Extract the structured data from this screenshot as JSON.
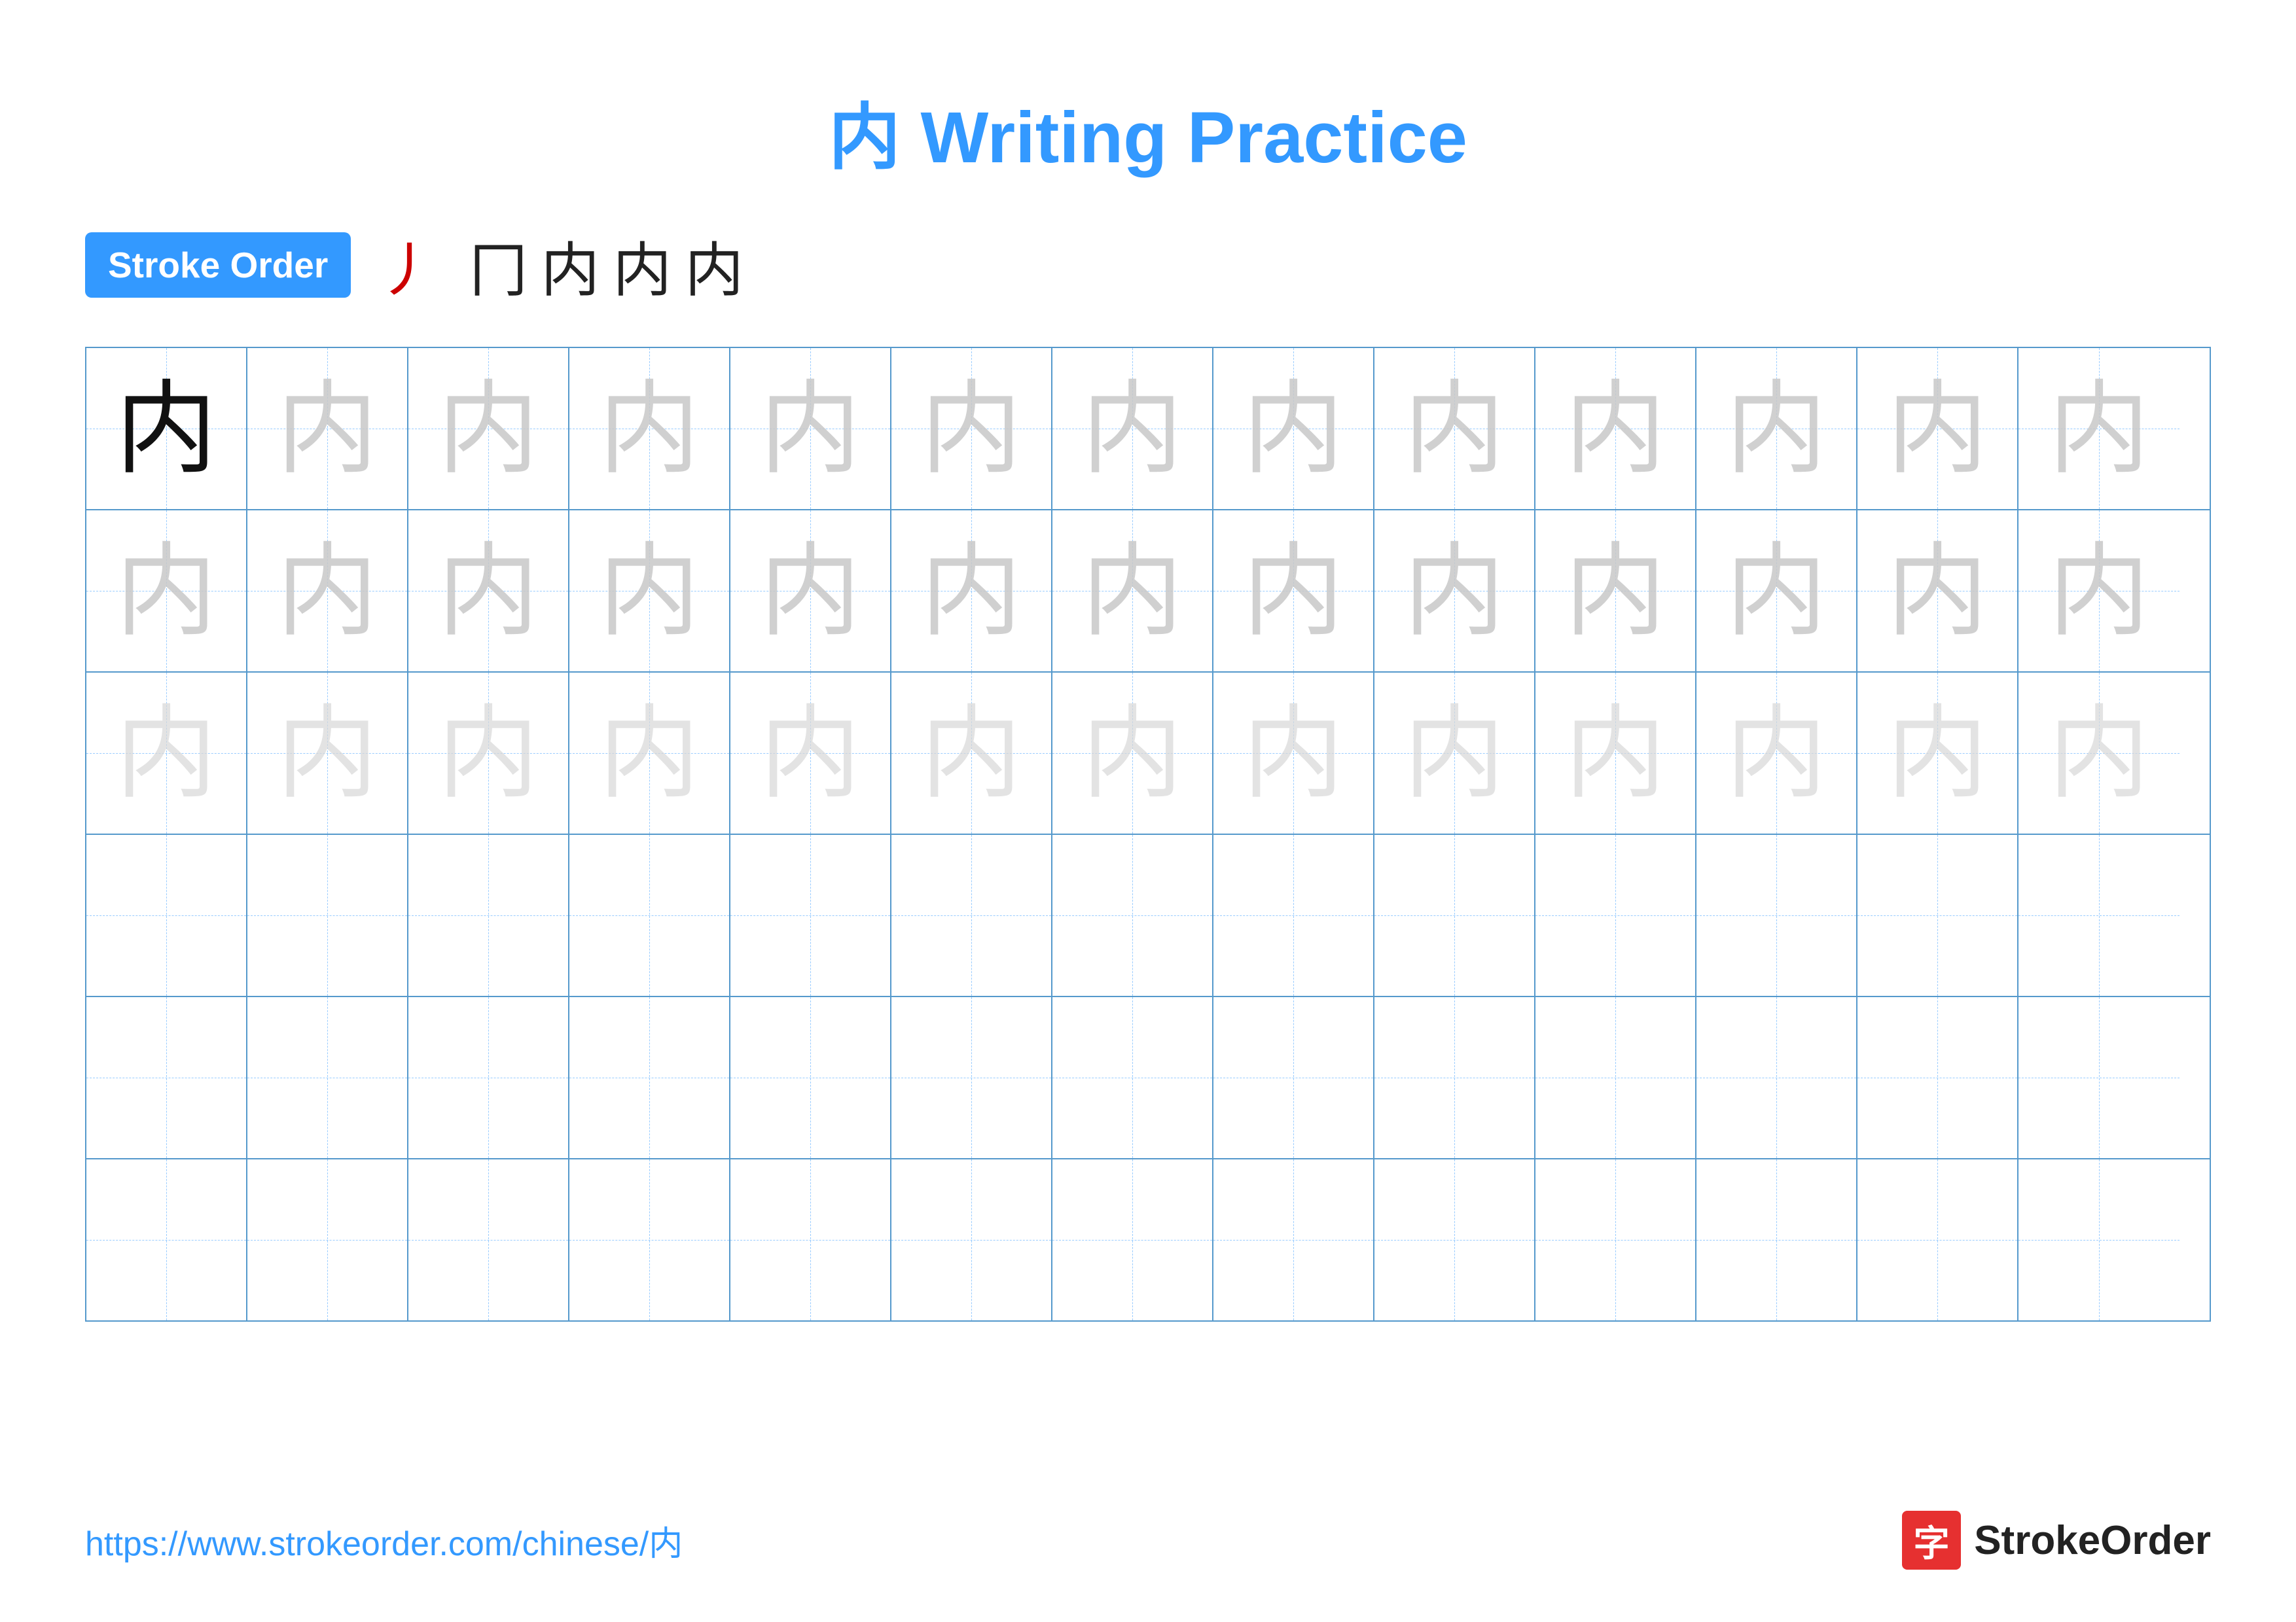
{
  "page": {
    "title": "内 Writing Practice",
    "title_color": "#3399ff"
  },
  "stroke_order": {
    "badge_label": "Stroke Order",
    "steps": [
      "丿",
      "冂",
      "内",
      "内",
      "内"
    ]
  },
  "grid": {
    "rows": 6,
    "cols": 13,
    "char": "内",
    "char_dark_count": 1,
    "char_light1_rows": 2,
    "char_light2_rows": 1,
    "empty_rows": 3
  },
  "footer": {
    "url": "https://www.strokeorder.com/chinese/内",
    "logo_char": "字",
    "logo_name": "StrokeOrder"
  }
}
